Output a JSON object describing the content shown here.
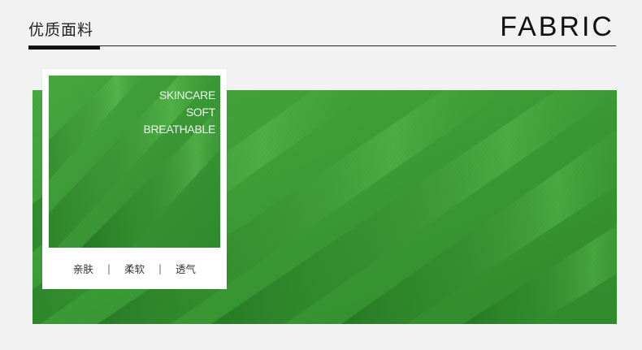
{
  "header": {
    "title_cn": "优质面料",
    "title_en": "FABRIC"
  },
  "hero": {
    "fabric_color": "#3a9a35",
    "highlight_color": "#5cc152",
    "shadow_color": "#1e6a1c"
  },
  "card": {
    "taglines": [
      "SKINCARE",
      "SOFT",
      "BREATHABLE"
    ],
    "features": [
      "亲肤",
      "柔软",
      "透气"
    ],
    "separator": "|"
  }
}
